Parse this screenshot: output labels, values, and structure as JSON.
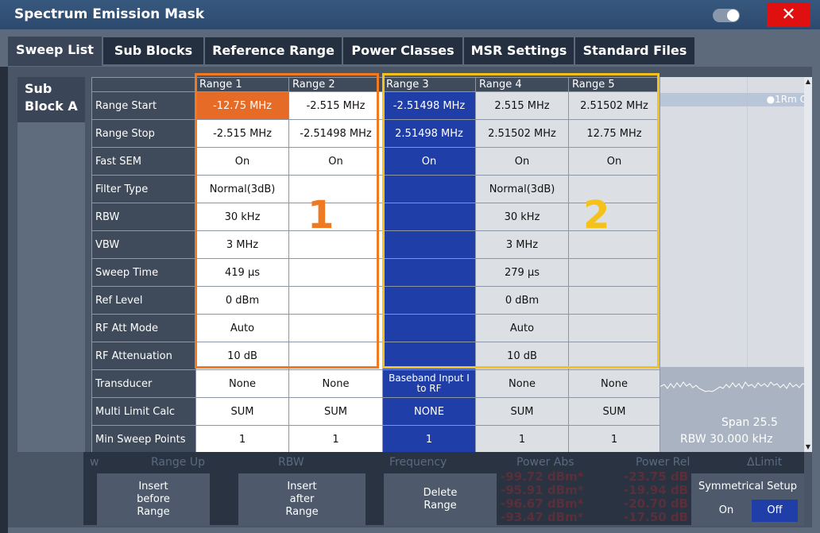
{
  "window": {
    "title": "Spectrum Emission Mask",
    "close_label": "✕"
  },
  "tabs": [
    "Sweep List",
    "Sub Blocks",
    "Reference Range",
    "Power Classes",
    "MSR Settings",
    "Standard Files"
  ],
  "subblock": {
    "label_line1": "Sub",
    "label_line2": "Block A"
  },
  "table": {
    "columns": [
      "Range 1",
      "Range 2",
      "Range 3",
      "Range 4",
      "Range 5"
    ],
    "rows": [
      {
        "label": "Range Start",
        "cells": [
          "-12.75 MHz",
          "-2.515 MHz",
          "-2.51498 MHz",
          "2.515 MHz",
          "2.51502 MHz"
        ]
      },
      {
        "label": "Range Stop",
        "cells": [
          "-2.515 MHz",
          "-2.51498 MHz",
          "2.51498 MHz",
          "2.51502 MHz",
          "12.75 MHz"
        ]
      },
      {
        "label": "Fast SEM",
        "cells": [
          "On",
          "On",
          "On",
          "On",
          "On"
        ]
      },
      {
        "label": "Filter Type",
        "cells": [
          "Normal(3dB)",
          "",
          "",
          "Normal(3dB)",
          ""
        ]
      },
      {
        "label": "RBW",
        "cells": [
          "30 kHz",
          "",
          "",
          "30 kHz",
          ""
        ]
      },
      {
        "label": "VBW",
        "cells": [
          "3 MHz",
          "",
          "",
          "3 MHz",
          ""
        ]
      },
      {
        "label": "Sweep Time",
        "cells": [
          "419 µs",
          "",
          "",
          "279 µs",
          ""
        ]
      },
      {
        "label": "Ref Level",
        "cells": [
          "0 dBm",
          "",
          "",
          "0 dBm",
          ""
        ]
      },
      {
        "label": "RF Att Mode",
        "cells": [
          "Auto",
          "",
          "",
          "Auto",
          ""
        ]
      },
      {
        "label": "RF Attenuation",
        "cells": [
          "10 dB",
          "",
          "",
          "10 dB",
          ""
        ]
      },
      {
        "label": "Transducer",
        "cells": [
          "None",
          "None",
          "Baseband Input I to RF",
          "None",
          "None"
        ]
      },
      {
        "label": "Multi Limit Calc",
        "cells": [
          "SUM",
          "SUM",
          "NONE",
          "SUM",
          "SUM"
        ]
      },
      {
        "label": "Min Sweep Points",
        "cells": [
          "1",
          "1",
          "1",
          "1",
          "1"
        ]
      }
    ]
  },
  "annotations": {
    "box1_number": "1",
    "box2_number": "2"
  },
  "graph": {
    "marker": "●1Rm C",
    "span": "Span 25.5",
    "rbw": "RBW  30.000 kHz"
  },
  "background": {
    "header": [
      "w",
      "Range Up",
      "RBW",
      "Frequency",
      "Power Abs",
      "Power Rel",
      "ΔLimit"
    ],
    "abs_values": [
      "-99.72 dBm*",
      "-95.91 dBm*",
      "-96.67 dBm*",
      "-93.47 dBm*"
    ],
    "rel_values": [
      "-23.75 dB",
      "-19.94 dB",
      "-20.70 dB",
      "-17.50 dB"
    ]
  },
  "buttons": {
    "insert_before": "Insert\nbefore\nRange",
    "insert_after": "Insert\nafter\nRange",
    "delete": "Delete\nRange"
  },
  "symmetrical": {
    "title": "Symmetrical Setup",
    "on": "On",
    "off": "Off"
  },
  "colors": {
    "range1_box": "#f07a22",
    "range2_box": "#f4c21a",
    "selected": "#1f3ea8",
    "close": "#e01010"
  }
}
